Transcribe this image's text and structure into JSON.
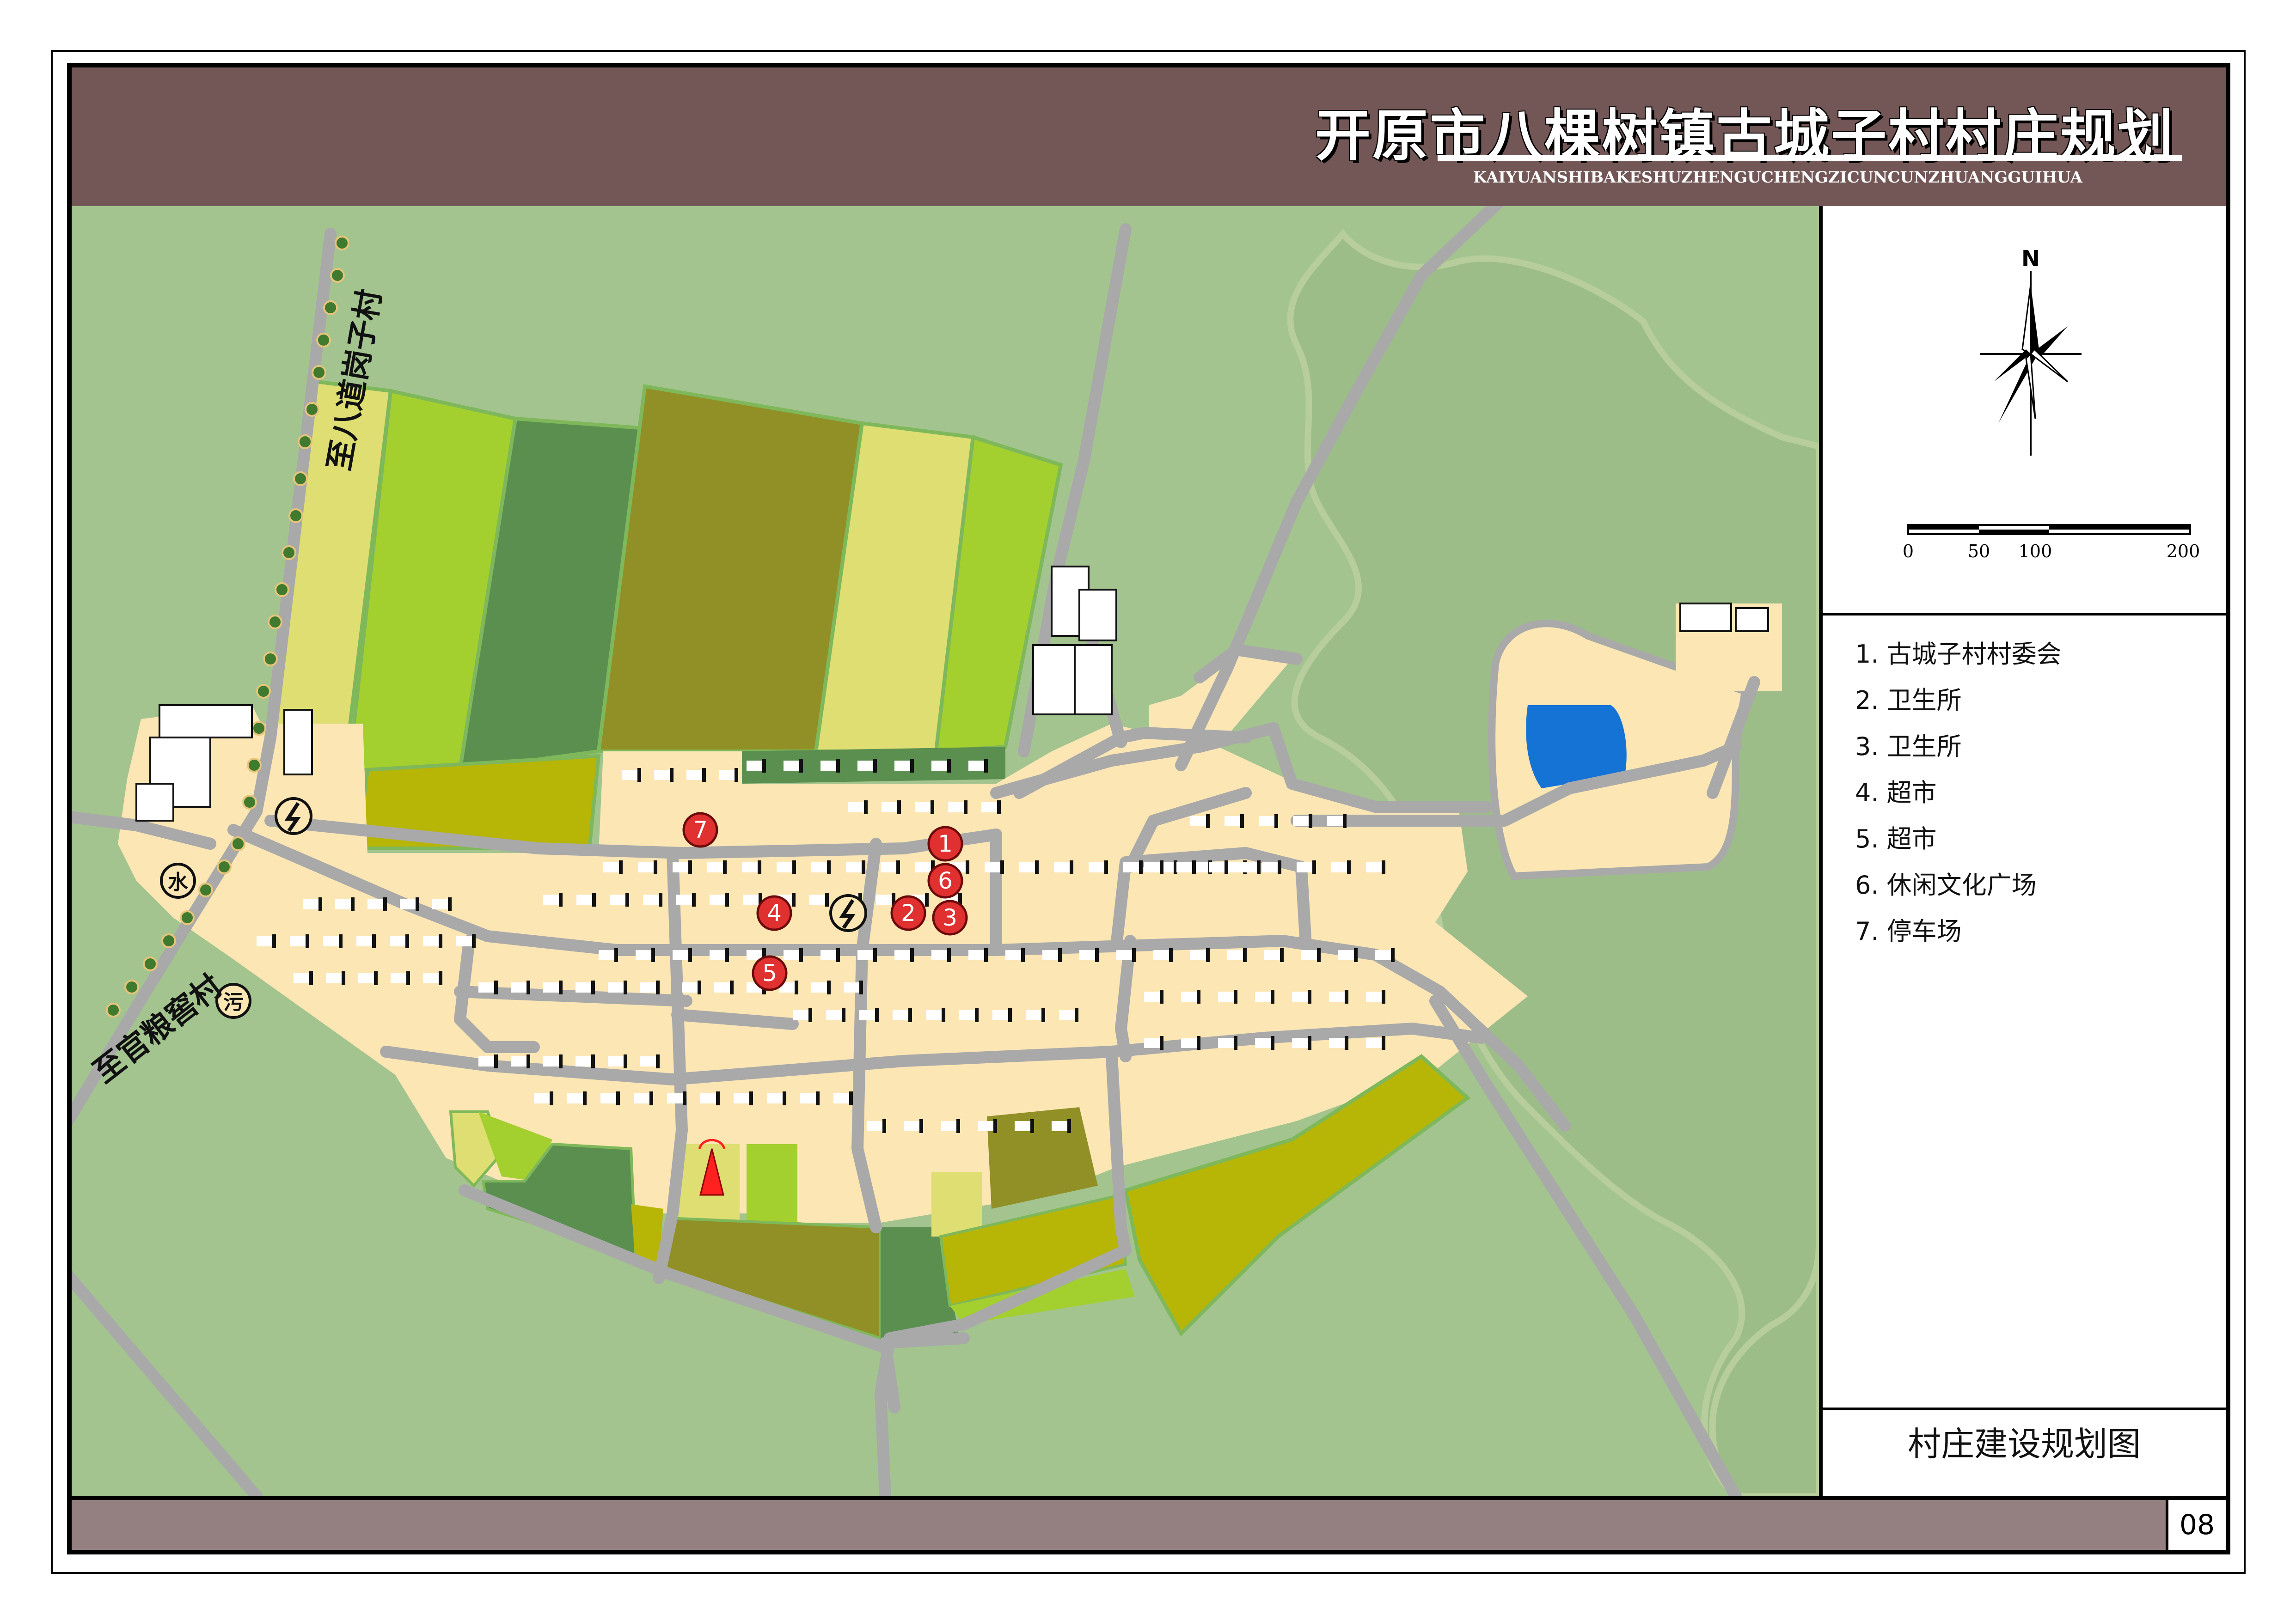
{
  "header": {
    "title": "开原市八棵树镇古城子村村庄规划",
    "subtitle": "KAIYUANSHIBAKESHUZHENGUCHENGZICUNCUNZHUANGGUIHUA"
  },
  "map": {
    "road_labels": [
      "至八道岗子村",
      "至官粮窖村"
    ],
    "facility_icons": {
      "water": "水",
      "sewage": "污",
      "power": "power-station-icon",
      "telecom": "telecom-tower-icon"
    },
    "markers": [
      "1",
      "2",
      "3",
      "4",
      "5",
      "6",
      "7"
    ],
    "colors": {
      "background": "#a3c48f",
      "residential": "#fbe6b4",
      "road": "#a9a9a9",
      "water": "#1673d6",
      "field_light_green": "#a3cf2f",
      "field_dark_green": "#5b8f50",
      "field_olive": "#919026",
      "field_pale": "#dede72",
      "field_yellow_olive": "#b7b505",
      "marker": "#e03030"
    }
  },
  "sidebar": {
    "north_label": "N",
    "scale_labels": [
      "0",
      "50",
      "100",
      "200"
    ],
    "legend_items": [
      "1. 古城子村村委会",
      "2. 卫生所",
      "3. 卫生所",
      "4. 超市",
      "5. 超市",
      "6. 休闲文化广场",
      "7. 停车场"
    ],
    "map_name": "村庄建设规划图"
  },
  "footer": {
    "page_number": "08"
  }
}
